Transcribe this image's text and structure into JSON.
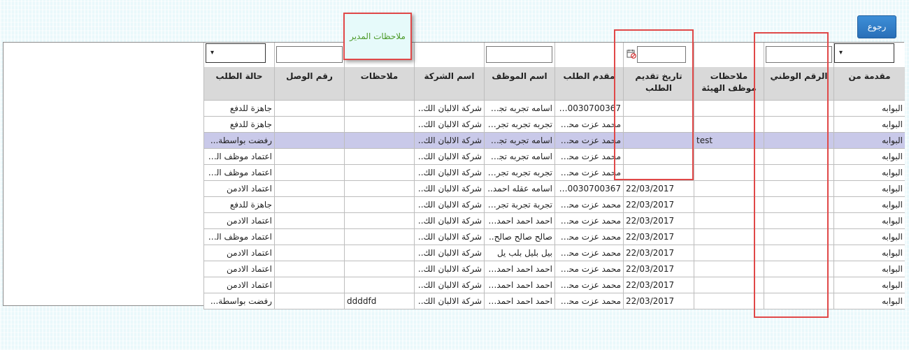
{
  "back_button": "رجوع",
  "manager_notes_label": "ملاحظات المدير",
  "columns": [
    "مقدمة من",
    "الرقم الوطني",
    "ملاحظات موظف الهيئة",
    "تاريخ تقديم الطلب",
    "مقدم الطلب",
    "اسم الموظف",
    "اسم الشركة",
    "ملاحظات",
    "رقم الوصل",
    "حالة الطلب"
  ],
  "rows": [
    [
      "البوابه",
      "",
      "",
      "",
      "60030700367..",
      "اسامه تجربه تجرب..",
      "شركة الالبان الك..",
      "",
      "",
      "جاهزة للدفع"
    ],
    [
      "البوابه",
      "",
      "",
      "",
      "محمد عزت محمـ..",
      "تجربه تجربه تجربه..",
      "شركة الالبان الك..",
      "",
      "",
      "جاهزة للدفع"
    ],
    [
      "البوابه",
      "",
      "test",
      "",
      "محمد عزت محمـ..",
      "اسامه تجربه تجرب..",
      "شركة الالبان الك..",
      "",
      "",
      "رفضت بواسطة..."
    ],
    [
      "البوابه",
      "",
      "",
      "",
      "محمد عزت محمـ..",
      "اسامه تجربه تجرب..",
      "شركة الالبان الك..",
      "",
      "",
      "اعتماد موظف الـ..."
    ],
    [
      "البوابه",
      "",
      "",
      "",
      "محمد عزت محمـ..",
      "تجربه تجربه تجربه..",
      "شركة الالبان الك..",
      "",
      "",
      "اعتماد موظف الـ..."
    ],
    [
      "البوابه",
      "",
      "",
      "22/03/2017",
      "60030700367..",
      "اسامه عقله احمد..",
      "شركة الالبان الك..",
      "",
      "",
      "اعتماد الادمن"
    ],
    [
      "البوابه",
      "",
      "",
      "22/03/2017",
      "محمد عزت محمـ..",
      "تجربة تجربة تجربة..",
      "شركة الالبان الك..",
      "",
      "",
      "جاهزة للدفع"
    ],
    [
      "البوابه",
      "",
      "",
      "22/03/2017",
      "محمد عزت محمـ..",
      "احمد احمد احمد ا..",
      "شركة الالبان الك..",
      "",
      "",
      "اعتماد الادمن"
    ],
    [
      "البوابه",
      "",
      "",
      "22/03/2017",
      "محمد عزت محمـ..",
      "صالح صالح صالح..",
      "شركة الالبان الك..",
      "",
      "",
      "اعتماد موظف الـ..."
    ],
    [
      "البوابه",
      "",
      "",
      "22/03/2017",
      "محمد عزت محمـ..",
      "بيل بليل بلب يل",
      "شركة الالبان الك..",
      "",
      "",
      "اعتماد الادمن"
    ],
    [
      "البوابه",
      "",
      "",
      "22/03/2017",
      "محمد عزت محمـ..",
      "احمد احمد احمد ا..",
      "شركة الالبان الك..",
      "",
      "",
      "اعتماد الادمن"
    ],
    [
      "البوابه",
      "",
      "",
      "22/03/2017",
      "محمد عزت محمـ..",
      "احمد احمد احمد ا..",
      "شركة الالبان الك..",
      "",
      "",
      "اعتماد الادمن"
    ],
    [
      "البوابه",
      "",
      "",
      "22/03/2017",
      "محمد عزت محمـ..",
      "احمد احمد احمد ا..",
      "شركة الالبان الك..",
      "ddddfd",
      "",
      "رفضت بواسطة..."
    ]
  ],
  "selected_row_index": 2,
  "filters": {
    "submitted_by_select": "▾",
    "status_select": "▾"
  },
  "colors": {
    "header_bg": "#d9d9d9",
    "selected_row_bg": "#c9c9e9",
    "highlight_red": "#e04848",
    "button_blue": "#2a6fb8",
    "note_text": "#4c9a2a"
  }
}
